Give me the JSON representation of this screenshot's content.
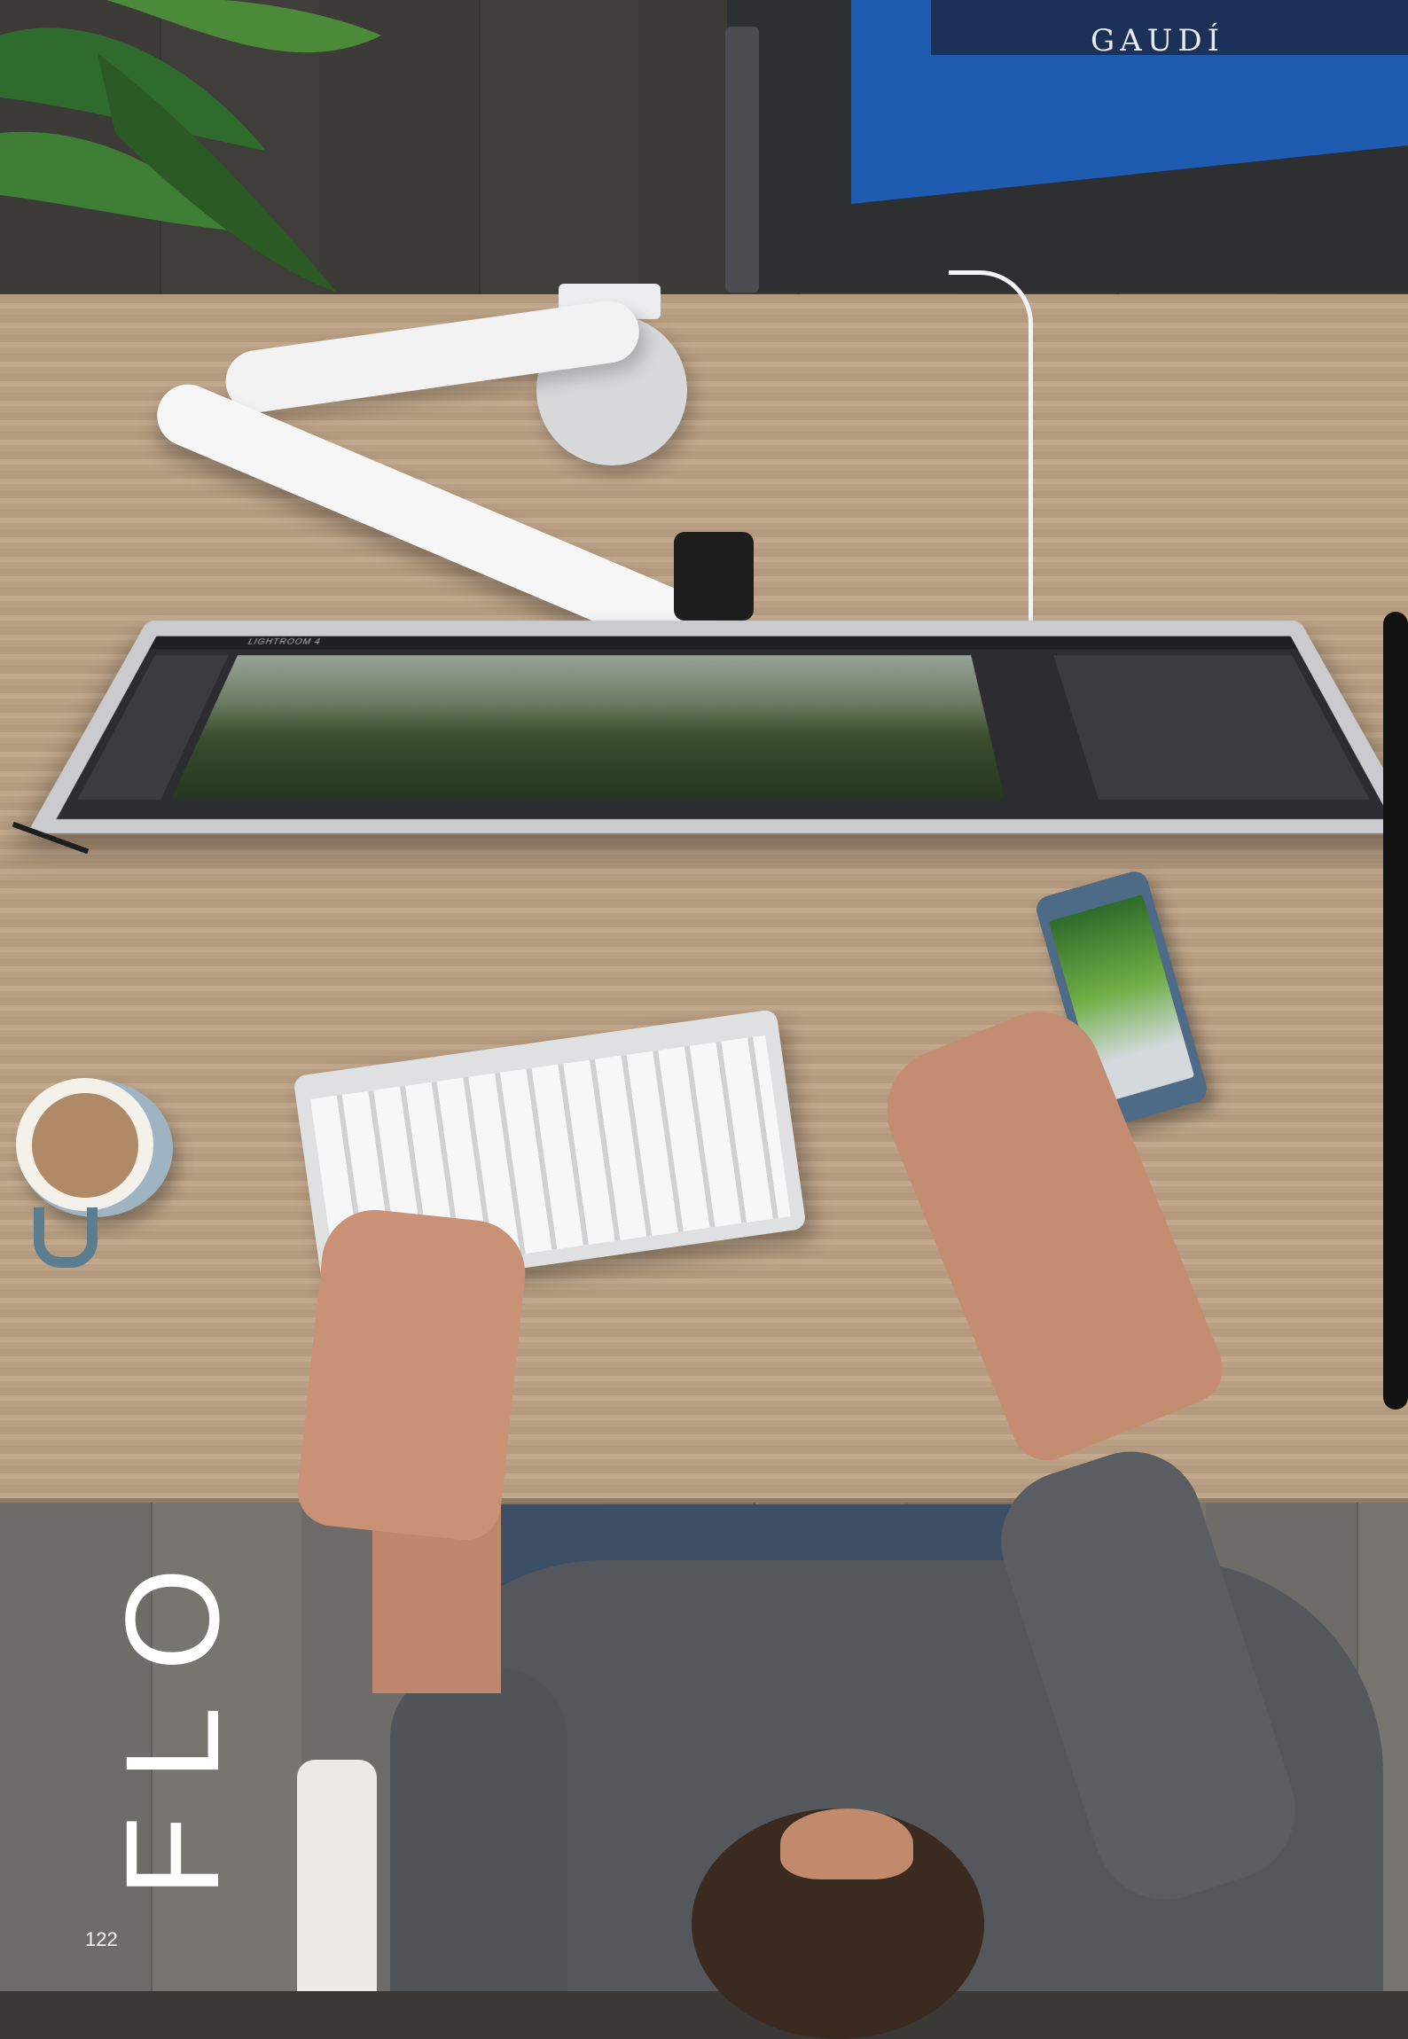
{
  "page": {
    "title": "FLO",
    "page_number": "122"
  },
  "monitor": {
    "app_label": "LIGHTROOM 4"
  },
  "book": {
    "cover_text": "GAUDÍ"
  }
}
